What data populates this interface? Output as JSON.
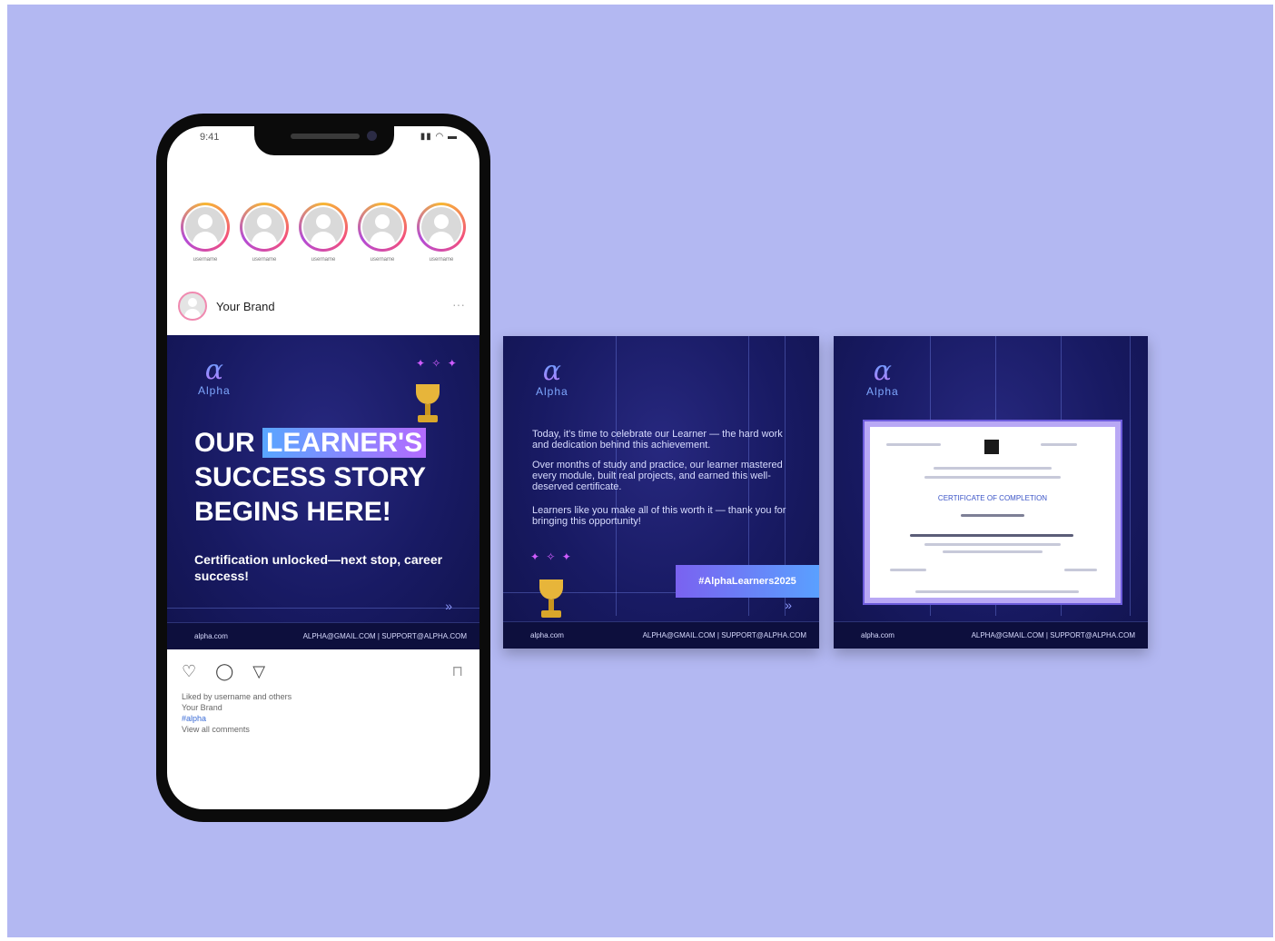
{
  "phone": {
    "status_time": "9:41",
    "status_icons": "▮▮ ◠ ▬",
    "stories": [
      {
        "name": "username"
      },
      {
        "name": "username"
      },
      {
        "name": "username"
      },
      {
        "name": "username"
      },
      {
        "name": "username"
      }
    ],
    "post_header": {
      "brand": "Your Brand",
      "more_icon": "···"
    },
    "post": {
      "logo_symbol": "α",
      "logo_name": "Alpha",
      "headline_1": "OUR ",
      "headline_highlight": "LEARNER'S",
      "headline_2": "SUCCESS STORY",
      "headline_3": "BEGINS HERE!",
      "subline": "Certification unlocked—next stop, career success!",
      "footer_left": "alpha.com",
      "footer_right": "ALPHA@GMAIL.COM  |  SUPPORT@ALPHA.COM",
      "arrow_icon": "»"
    },
    "actions": {
      "icons": "♡ ◯ ▽",
      "bookmark": "⊓"
    },
    "likes": {
      "line1": "Liked by username and others",
      "line2": "Your Brand",
      "line3": "#alpha",
      "line4": "View all comments"
    }
  },
  "slide2": {
    "logo_symbol": "α",
    "logo_name": "Alpha",
    "para1": "Today, it's time to celebrate our Learner — the hard work and dedication behind this achievement.",
    "para2": "Over months of study and practice, our learner mastered every module, built real projects, and earned this well-deserved certificate.",
    "para3": "Learners like you make all of this worth it — thank you for bringing this opportunity!",
    "cta": "#AlphaLearners2025",
    "footer_left": "alpha.com",
    "footer_right": "ALPHA@GMAIL.COM  |  SUPPORT@ALPHA.COM",
    "arrow_icon": "»"
  },
  "slide3": {
    "logo_symbol": "α",
    "logo_name": "Alpha",
    "cert_title": "CERTIFICATE OF COMPLETION",
    "footer_left": "alpha.com",
    "footer_right": "ALPHA@GMAIL.COM  |  SUPPORT@ALPHA.COM"
  },
  "colors": {
    "background": "#b3b8f2",
    "panel": "#181a63",
    "accent_blue": "#58a6ff",
    "accent_purple": "#b36bff",
    "trophy": "#e7b53a"
  }
}
